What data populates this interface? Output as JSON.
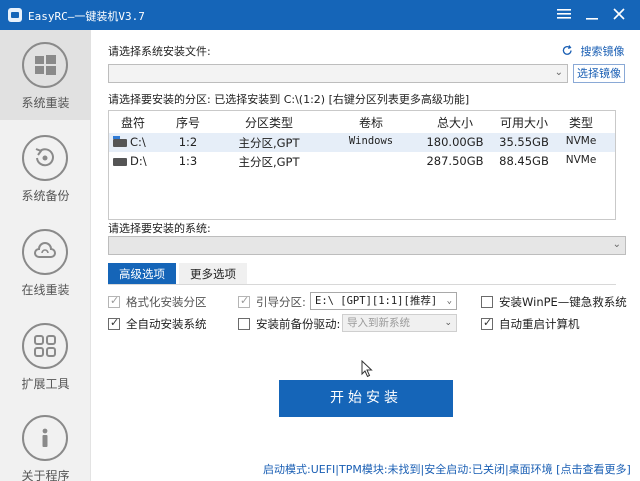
{
  "window": {
    "title": "EasyRC—一键装机V3.7",
    "menu_icon": "hamburger-icon",
    "minimize_icon": "minimize-icon",
    "close_icon": "close-icon",
    "accent": "#1565b8"
  },
  "sidebar": {
    "items": [
      {
        "label": "系统重装",
        "icon": "windows-icon",
        "active": true
      },
      {
        "label": "系统备份",
        "icon": "backup-icon",
        "active": false
      },
      {
        "label": "在线重装",
        "icon": "cloud-icon",
        "active": false
      },
      {
        "label": "扩展工具",
        "icon": "tools-icon",
        "active": false
      },
      {
        "label": "关于程序",
        "icon": "info-icon",
        "active": false
      }
    ]
  },
  "file_section": {
    "label": "请选择系统安装文件:",
    "search_link": "搜索镜像",
    "choose_button": "选择镜像",
    "file_value": ""
  },
  "partition_section": {
    "label": "请选择要安装的分区: 已选择安装到 C:\\(1:2) [右键分区列表更多高级功能]",
    "columns": [
      "盘符",
      "序号",
      "分区类型",
      "卷标",
      "总大小",
      "可用大小",
      "类型"
    ],
    "rows": [
      {
        "drive": "C:\\",
        "index": "1:2",
        "ptype": "主分区,GPT",
        "volume": "Windows",
        "total": "180.00GB",
        "free": "35.55GB",
        "type": "NVMe",
        "selected": true
      },
      {
        "drive": "D:\\",
        "index": "1:3",
        "ptype": "主分区,GPT",
        "volume": "",
        "total": "287.50GB",
        "free": "88.45GB",
        "type": "NVMe",
        "selected": false
      }
    ]
  },
  "system_section": {
    "label": "请选择要安装的系统:",
    "value": ""
  },
  "tabs": [
    {
      "label": "高级选项",
      "active": true
    },
    {
      "label": "更多选项",
      "active": false
    }
  ],
  "options": {
    "format": {
      "label": "格式化安装分区",
      "checked": true,
      "disabled": true
    },
    "auto_install": {
      "label": "全自动安装系统",
      "checked": true,
      "disabled": false
    },
    "boot_partition": {
      "label": "引导分区:",
      "checked": true,
      "disabled": true,
      "select_value": "E:\\ [GPT][1:1][推荐]"
    },
    "backup_drivers": {
      "label": "安装前备份驱动:",
      "checked": false,
      "disabled": false,
      "select_value": "导入到新系统"
    },
    "winpe": {
      "label": "安装WinPE—键急救系统",
      "checked": false,
      "disabled": false
    },
    "auto_restart": {
      "label": "自动重启计算机",
      "checked": true,
      "disabled": false
    }
  },
  "start_button": "开始安装",
  "status_bar": "启动模式:UEFI|TPM模块:未找到|安全启动:已关闭|桌面环境 [点击查看更多]"
}
